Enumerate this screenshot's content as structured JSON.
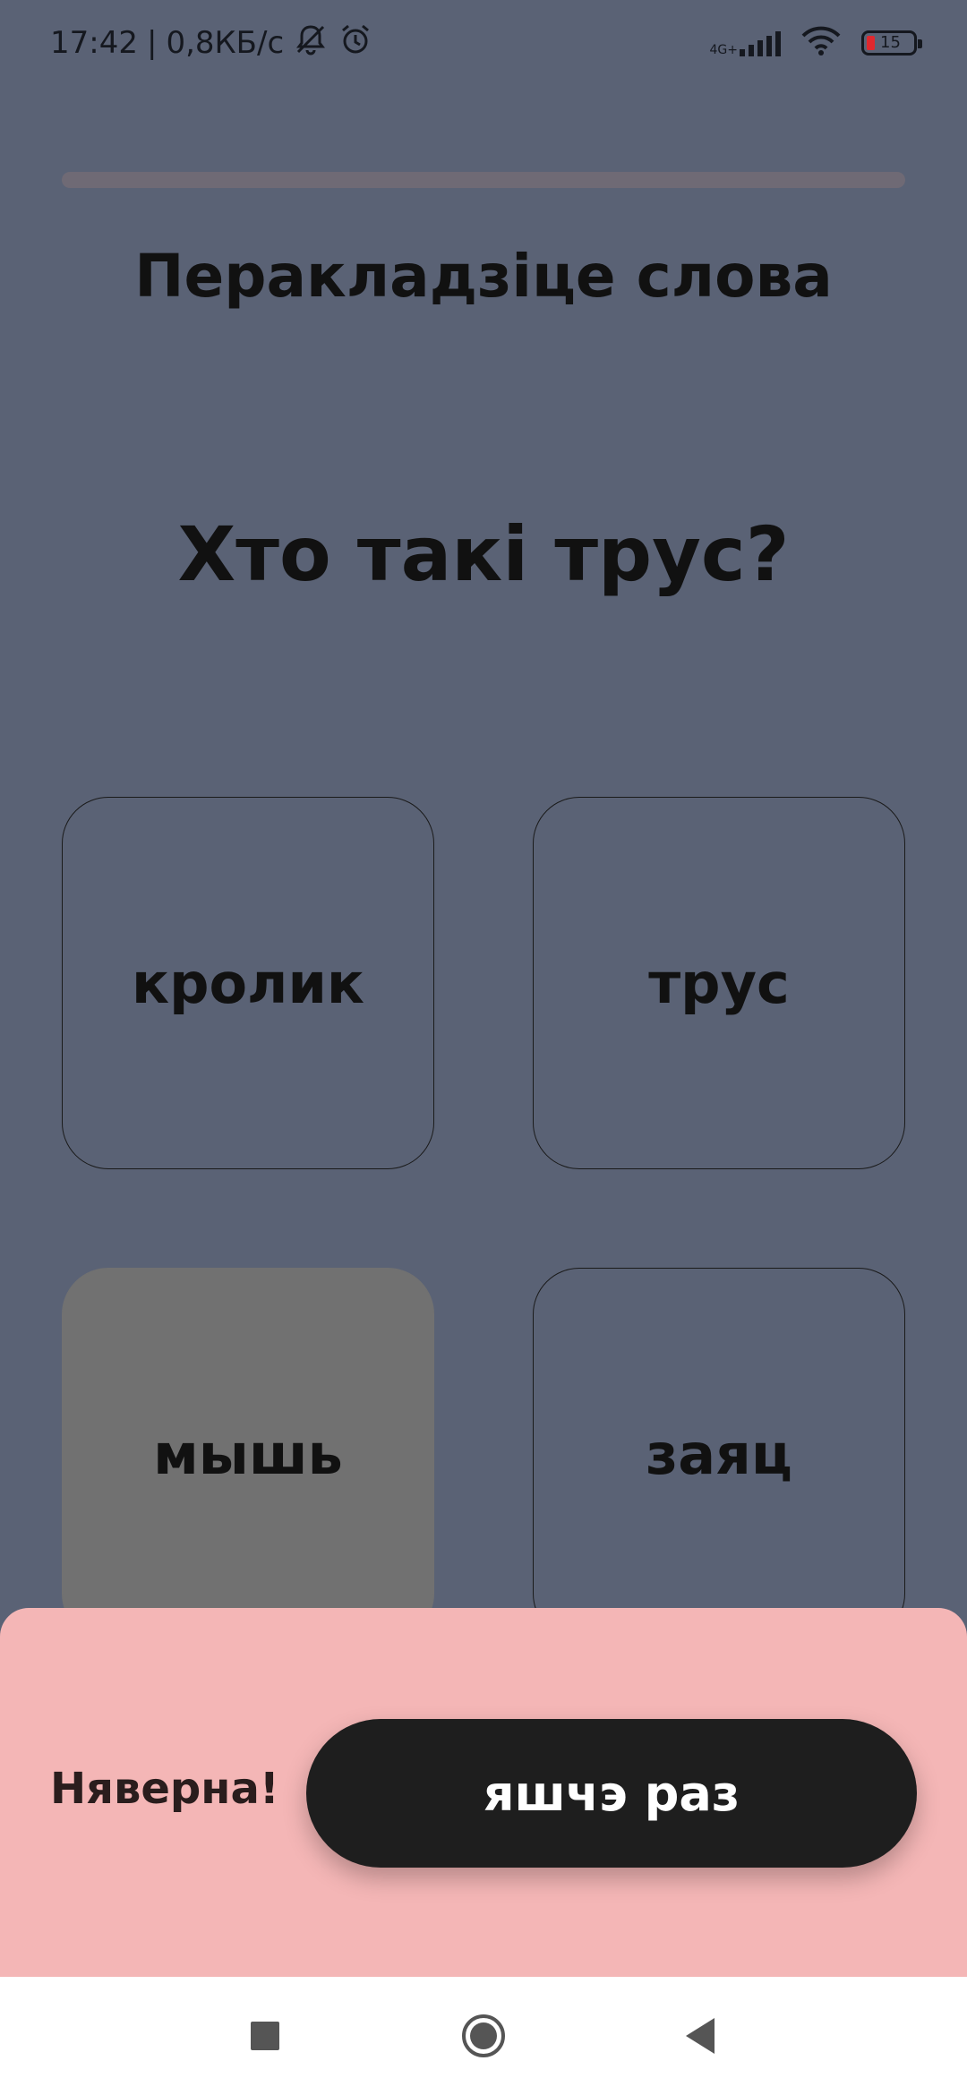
{
  "status_bar": {
    "time": "17:42",
    "separator": "|",
    "speed": "0,8КБ/с",
    "network": "4G+",
    "battery_level": "15",
    "battery_color": "#e0282e"
  },
  "progress": {
    "value": 0
  },
  "exercise": {
    "title": "Перакладзіце слова",
    "question": "Хто такі трус?"
  },
  "options": [
    {
      "label": "кролик",
      "state": "default"
    },
    {
      "label": "трус",
      "state": "default"
    },
    {
      "label": "мышь",
      "state": "selected"
    },
    {
      "label": "заяц",
      "state": "default"
    }
  ],
  "feedback": {
    "message": "Няверна!",
    "retry_label": "яшчэ раз",
    "color": "#f4b6b6"
  },
  "colors": {
    "background": "#5a6275",
    "selected_option": "#717171",
    "button": "#1e1e1e"
  },
  "icons": {
    "status": [
      "mute-icon",
      "alarm-icon",
      "signal-icon",
      "wifi-icon",
      "battery-icon"
    ],
    "nav": [
      "recents-square-icon",
      "home-circle-icon",
      "back-triangle-icon"
    ]
  }
}
